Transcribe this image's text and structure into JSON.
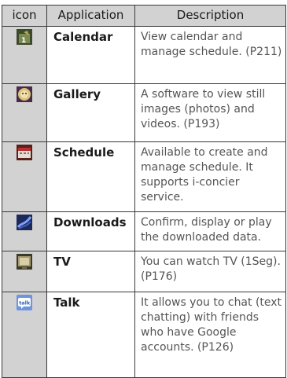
{
  "headers": {
    "icon": "icon",
    "application": "Application",
    "description": "Description"
  },
  "rows": [
    {
      "icon": "calendar-icon",
      "app": "Calendar",
      "desc": "View calendar and manage schedule. (P211)"
    },
    {
      "icon": "gallery-icon",
      "app": "Gallery",
      "desc": "A software to view still images (photos) and videos. (P193)"
    },
    {
      "icon": "schedule-icon",
      "app": "Schedule",
      "desc": "Available to create and manage schedule. It supports i-concier service."
    },
    {
      "icon": "downloads-icon",
      "app": "Downloads",
      "desc": "Confirm, display or play the downloaded data."
    },
    {
      "icon": "tv-icon",
      "app": "TV",
      "desc": "You can watch TV (1Seg). (P176)"
    },
    {
      "icon": "talk-icon",
      "app": "Talk",
      "desc": "It allows you to chat (text chatting) with friends who have Google accounts. (P126)",
      "icon_text": "talk"
    }
  ]
}
